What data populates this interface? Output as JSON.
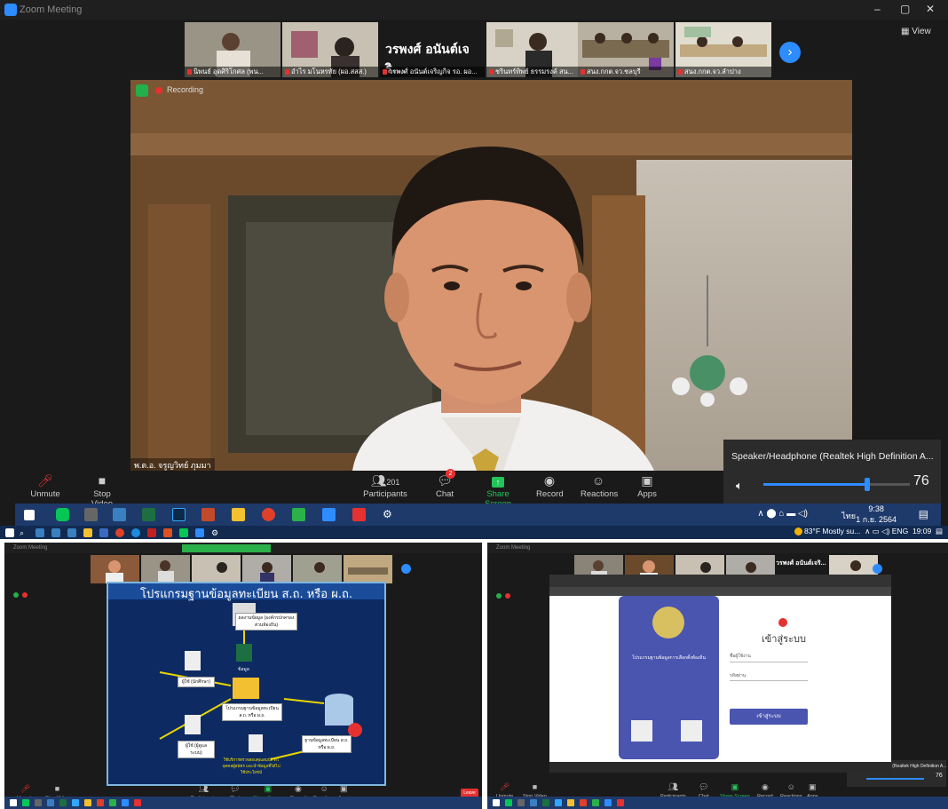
{
  "window": {
    "title": "Zoom Meeting",
    "minimize": "–",
    "restore": "▢",
    "close": "✕",
    "view_label": "▦ View"
  },
  "gallery": {
    "thumbs": [
      {
        "name": "นิพนธ์ อุดศิริโกศล (พน..."
      },
      {
        "name": "อำไร มโนหรทัย (ผอ.สสส.)"
      },
      {
        "name": "วรพงศ์ อนันต์เจริญกิจ รอ. ผอ..."
      },
      {
        "name": "ชรินทร์ทิพย์ ธรรมรงค์ สน..."
      },
      {
        "name": "สนง.กกต.จว.ชลบุรี"
      },
      {
        "name": "สนง.กกต.จว.ลำปาง"
      }
    ],
    "speaker_big": "วรพงศ์ อนันต์เจริ..."
  },
  "recording": {
    "label": "Recording"
  },
  "active_speaker": {
    "name": "พ.ต.อ. จรูญวิทย์ ภุมมา"
  },
  "audio": {
    "device": "Speaker/Headphone (Realtek High Definition A...",
    "volume": "76",
    "level": 0.72
  },
  "controls": {
    "unmute": "Unmute",
    "stop_video": "Stop Video",
    "participants": "Participants",
    "participant_count": "201",
    "chat": "Chat",
    "chat_badge": "2",
    "share_screen": "Share Screen",
    "record": "Record",
    "reactions": "Reactions",
    "apps": "Apps"
  },
  "taskbar": {
    "time": "9:38",
    "date": "1 ก.ย. 2564",
    "lang": "ไทย"
  },
  "outer_taskbar": {
    "weather": "83°F  Mostly su...",
    "lang": "ENG",
    "time": "19:09"
  },
  "slide": {
    "title": "โปรแกรมฐานข้อมูลทะเบียน ส.ถ. หรือ ผ.ถ.",
    "box_owner": "ผลงานข้อมูล\n(องค์กรปกครองส่วนท้องถิ่น)",
    "excel_label": "ข้อมูล",
    "user1": "ผู้ใช้ (นักศึกษา)",
    "user2": "ผู้ใช้ (ผู้ดูแลระบบ)",
    "program": "โปรแกรมฐานข้อมูลทะเบียน ส.ถ. หรือ ผ.ถ.",
    "db": "ฐานข้อมูลทะเบียน ส.ถ. หรือ ผ.ถ.",
    "note": "ใช้บริการตรวจสอบคุณสมบัติ\nตัวบุคคลผู้สมัคร\nและนำข้อมูลที่ได้ไปใช้ประโยชน์"
  },
  "bottom_left": {
    "title": "Zoom Meeting",
    "leave": "Leave"
  },
  "bottom_right": {
    "title": "Zoom Meeting",
    "login_title": "เข้าสู่ระบบ",
    "login_button": "เข้าสู่ระบบ",
    "left_heading": "โปรแกรมฐานข้อมูลการเลือกตั้งท้องถิ่น",
    "username_label": "ชื่อผู้ใช้งาน",
    "password_label": "รหัสผ่าน",
    "audio": "Speaker/Headphone (Realtek High Definition A...",
    "volume": "76"
  },
  "colors": {
    "zoom_blue": "#2d8cff",
    "share_green": "#24c45a",
    "record_red": "#e5312f"
  }
}
